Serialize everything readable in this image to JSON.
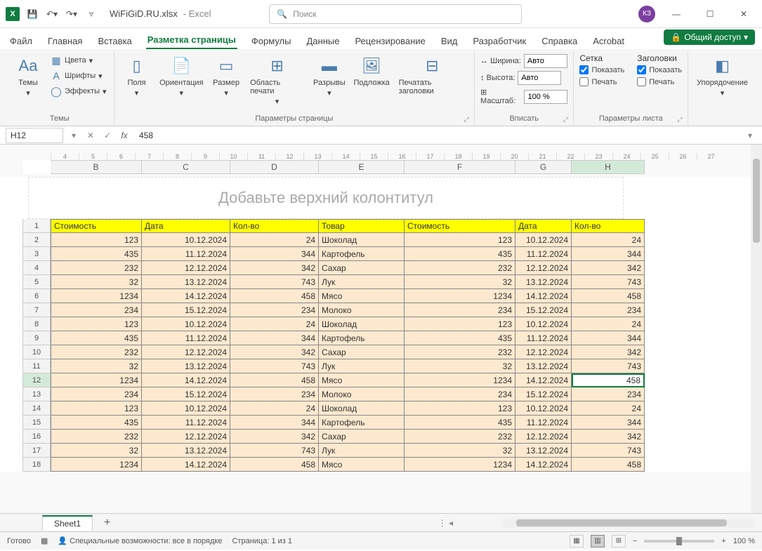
{
  "title": {
    "filename": "WiFiGiD.RU.xlsx",
    "app": "Excel",
    "search_placeholder": "Поиск",
    "avatar": "КЗ"
  },
  "tabs": {
    "file": "Файл",
    "home": "Главная",
    "insert": "Вставка",
    "pagelayout": "Разметка страницы",
    "formulas": "Формулы",
    "data": "Данные",
    "review": "Рецензирование",
    "view": "Вид",
    "developer": "Разработчик",
    "help": "Справка",
    "acrobat": "Acrobat",
    "share": "Общий доступ"
  },
  "ribbon": {
    "themes": {
      "themes": "Темы",
      "colors": "Цвета",
      "fonts": "Шрифты",
      "effects": "Эффекты",
      "group": "Темы"
    },
    "pagesetup": {
      "margins": "Поля",
      "orientation": "Ориентация",
      "size": "Размер",
      "printarea": "Область печати",
      "breaks": "Разрывы",
      "background": "Подложка",
      "printtitles": "Печатать заголовки",
      "group": "Параметры страницы"
    },
    "fit": {
      "width_lbl": "Ширина:",
      "height_lbl": "Высота:",
      "scale_lbl": "Масштаб:",
      "auto": "Авто",
      "scale_val": "100 %",
      "group": "Вписать"
    },
    "sheetopts": {
      "gridlines": "Сетка",
      "headings": "Заголовки",
      "show": "Показать",
      "print": "Печать",
      "group": "Параметры листа"
    },
    "arrange": {
      "arrange": "Упорядочение"
    }
  },
  "formulabar": {
    "namebox": "H12",
    "value": "458"
  },
  "sheet": {
    "header_placeholder": "Добавьте верхний колонтитул",
    "columns": [
      "B",
      "C",
      "D",
      "E",
      "F",
      "G",
      "H"
    ],
    "ruler": [
      "4",
      "5",
      "6",
      "7",
      "8",
      "9",
      "10",
      "11",
      "12",
      "13",
      "14",
      "15",
      "16",
      "17",
      "18",
      "19",
      "20",
      "21",
      "22",
      "23",
      "24",
      "25",
      "26",
      "27"
    ],
    "headers": [
      "Стоимость",
      "Дата",
      "Кол-во",
      "Товар",
      "Стоимость",
      "Дата",
      "Кол-во"
    ],
    "rows": [
      {
        "n": 2,
        "c": [
          "123",
          "10.12.2024",
          "24",
          "Шоколад",
          "123",
          "10.12.2024",
          "24"
        ]
      },
      {
        "n": 3,
        "c": [
          "435",
          "11.12.2024",
          "344",
          "Картофель",
          "435",
          "11.12.2024",
          "344"
        ]
      },
      {
        "n": 4,
        "c": [
          "232",
          "12.12.2024",
          "342",
          "Сахар",
          "232",
          "12.12.2024",
          "342"
        ]
      },
      {
        "n": 5,
        "c": [
          "32",
          "13.12.2024",
          "743",
          "Лук",
          "32",
          "13.12.2024",
          "743"
        ]
      },
      {
        "n": 6,
        "c": [
          "1234",
          "14.12.2024",
          "458",
          "Мясо",
          "1234",
          "14.12.2024",
          "458"
        ]
      },
      {
        "n": 7,
        "c": [
          "234",
          "15.12.2024",
          "234",
          "Молоко",
          "234",
          "15.12.2024",
          "234"
        ]
      },
      {
        "n": 8,
        "c": [
          "123",
          "10.12.2024",
          "24",
          "Шоколад",
          "123",
          "10.12.2024",
          "24"
        ]
      },
      {
        "n": 9,
        "c": [
          "435",
          "11.12.2024",
          "344",
          "Картофель",
          "435",
          "11.12.2024",
          "344"
        ]
      },
      {
        "n": 10,
        "c": [
          "232",
          "12.12.2024",
          "342",
          "Сахар",
          "232",
          "12.12.2024",
          "342"
        ]
      },
      {
        "n": 11,
        "c": [
          "32",
          "13.12.2024",
          "743",
          "Лук",
          "32",
          "13.12.2024",
          "743"
        ]
      },
      {
        "n": 12,
        "c": [
          "1234",
          "14.12.2024",
          "458",
          "Мясо",
          "1234",
          "14.12.2024",
          "458"
        ]
      },
      {
        "n": 13,
        "c": [
          "234",
          "15.12.2024",
          "234",
          "Молоко",
          "234",
          "15.12.2024",
          "234"
        ]
      },
      {
        "n": 14,
        "c": [
          "123",
          "10.12.2024",
          "24",
          "Шоколад",
          "123",
          "10.12.2024",
          "24"
        ]
      },
      {
        "n": 15,
        "c": [
          "435",
          "11.12.2024",
          "344",
          "Картофель",
          "435",
          "11.12.2024",
          "344"
        ]
      },
      {
        "n": 16,
        "c": [
          "232",
          "12.12.2024",
          "342",
          "Сахар",
          "232",
          "12.12.2024",
          "342"
        ]
      },
      {
        "n": 17,
        "c": [
          "32",
          "13.12.2024",
          "743",
          "Лук",
          "32",
          "13.12.2024",
          "743"
        ]
      },
      {
        "n": 18,
        "c": [
          "1234",
          "14.12.2024",
          "458",
          "Мясо",
          "1234",
          "14.12.2024",
          "458"
        ]
      }
    ],
    "selected_cell": "H12",
    "sheet_name": "Sheet1"
  },
  "status": {
    "ready": "Готово",
    "accessibility": "Специальные возможности: все в порядке",
    "page": "Страница: 1 из 1",
    "zoom": "100 %"
  }
}
